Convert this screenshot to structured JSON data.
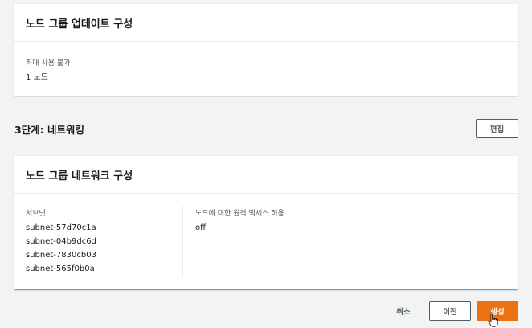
{
  "update_config": {
    "title": "노드 그룹 업데이트 구성",
    "max_unavailable_label": "최대 사용 불가",
    "max_unavailable_value": "1 노드"
  },
  "step3": {
    "title": "3단계: 네트워킹",
    "edit_label": "편집"
  },
  "network_config": {
    "title": "노드 그룹 네트워크 구성",
    "subnets_label": "서브넷",
    "subnets": [
      "subnet-57d70c1a",
      "subnet-04b9dc6d",
      "subnet-7830cb03",
      "subnet-565f0b0a"
    ],
    "remote_access_label": "노드에 대한 원격 액세스 허용",
    "remote_access_value": "off"
  },
  "footer": {
    "cancel_label": "취소",
    "previous_label": "이전",
    "create_label": "생성"
  },
  "colors": {
    "primary": "#ec7211",
    "background": "#f2f3f3"
  }
}
